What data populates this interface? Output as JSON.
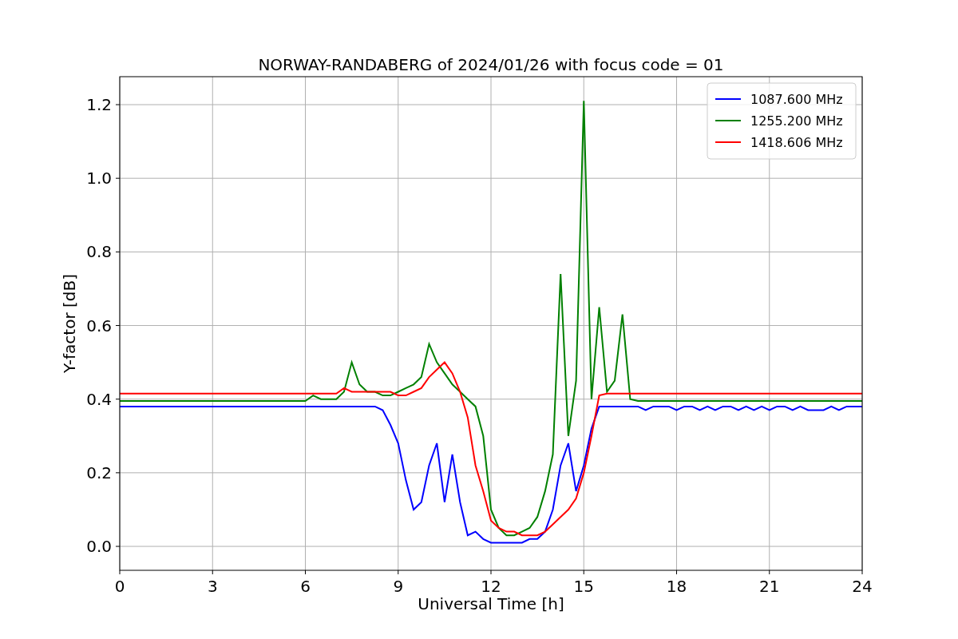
{
  "figure": {
    "chart_data": {
      "type": "line",
      "title": "NORWAY-RANDABERG of 2024/01/26 with focus code = 01",
      "xlabel": "Universal Time [h]",
      "ylabel": "Y-factor [dB]",
      "x": [
        0,
        0.25,
        0.5,
        0.75,
        1,
        1.25,
        1.5,
        1.75,
        2,
        2.25,
        2.5,
        2.75,
        3,
        3.25,
        3.5,
        3.75,
        4,
        4.25,
        4.5,
        4.75,
        5,
        5.25,
        5.5,
        5.75,
        6,
        6.25,
        6.5,
        6.75,
        7,
        7.25,
        7.5,
        7.75,
        8,
        8.25,
        8.5,
        8.75,
        9,
        9.25,
        9.5,
        9.75,
        10,
        10.25,
        10.5,
        10.75,
        11,
        11.25,
        11.5,
        11.75,
        12,
        12.25,
        12.5,
        12.75,
        13,
        13.25,
        13.5,
        13.75,
        14,
        14.25,
        14.5,
        14.75,
        15,
        15.25,
        15.5,
        15.75,
        16,
        16.25,
        16.5,
        16.75,
        17,
        17.25,
        17.5,
        17.75,
        18,
        18.25,
        18.5,
        18.75,
        19,
        19.25,
        19.5,
        19.75,
        20,
        20.25,
        20.5,
        20.75,
        21,
        21.25,
        21.5,
        21.75,
        22,
        22.25,
        22.5,
        22.75,
        23,
        23.25,
        23.5,
        23.75,
        24
      ],
      "series": [
        {
          "name": "1087.600 MHz",
          "color": "#0000ff",
          "values": [
            0.38,
            0.38,
            0.38,
            0.38,
            0.38,
            0.38,
            0.38,
            0.38,
            0.38,
            0.38,
            0.38,
            0.38,
            0.38,
            0.38,
            0.38,
            0.38,
            0.38,
            0.38,
            0.38,
            0.38,
            0.38,
            0.38,
            0.38,
            0.38,
            0.38,
            0.38,
            0.38,
            0.38,
            0.38,
            0.38,
            0.38,
            0.38,
            0.38,
            0.38,
            0.37,
            0.33,
            0.28,
            0.18,
            0.1,
            0.12,
            0.22,
            0.28,
            0.12,
            0.25,
            0.12,
            0.03,
            0.04,
            0.02,
            0.01,
            0.01,
            0.01,
            0.01,
            0.01,
            0.02,
            0.02,
            0.04,
            0.1,
            0.22,
            0.28,
            0.15,
            0.22,
            0.32,
            0.38,
            0.38,
            0.38,
            0.38,
            0.38,
            0.38,
            0.37,
            0.38,
            0.38,
            0.38,
            0.37,
            0.38,
            0.38,
            0.37,
            0.38,
            0.37,
            0.38,
            0.38,
            0.37,
            0.38,
            0.37,
            0.38,
            0.37,
            0.38,
            0.38,
            0.37,
            0.38,
            0.37,
            0.37,
            0.37,
            0.38,
            0.37,
            0.38,
            0.38,
            0.38
          ]
        },
        {
          "name": "1255.200 MHz",
          "color": "#008000",
          "values": [
            0.395,
            0.395,
            0.395,
            0.395,
            0.395,
            0.395,
            0.395,
            0.395,
            0.395,
            0.395,
            0.395,
            0.395,
            0.395,
            0.395,
            0.395,
            0.395,
            0.395,
            0.395,
            0.395,
            0.395,
            0.395,
            0.395,
            0.395,
            0.395,
            0.395,
            0.41,
            0.4,
            0.4,
            0.4,
            0.42,
            0.5,
            0.44,
            0.42,
            0.42,
            0.41,
            0.41,
            0.42,
            0.43,
            0.44,
            0.46,
            0.55,
            0.5,
            0.47,
            0.44,
            0.42,
            0.4,
            0.38,
            0.3,
            0.1,
            0.05,
            0.03,
            0.03,
            0.04,
            0.05,
            0.08,
            0.15,
            0.25,
            0.74,
            0.3,
            0.45,
            1.21,
            0.4,
            0.65,
            0.42,
            0.45,
            0.63,
            0.4,
            0.395,
            0.395,
            0.395,
            0.395,
            0.395,
            0.395,
            0.395,
            0.395,
            0.395,
            0.395,
            0.395,
            0.395,
            0.395,
            0.395,
            0.395,
            0.395,
            0.395,
            0.395,
            0.395,
            0.395,
            0.395,
            0.395,
            0.395,
            0.395,
            0.395,
            0.395,
            0.395,
            0.395,
            0.395,
            0.395
          ]
        },
        {
          "name": "1418.606 MHz",
          "color": "#ff0000",
          "values": [
            0.415,
            0.415,
            0.415,
            0.415,
            0.415,
            0.415,
            0.415,
            0.415,
            0.415,
            0.415,
            0.415,
            0.415,
            0.415,
            0.415,
            0.415,
            0.415,
            0.415,
            0.415,
            0.415,
            0.415,
            0.415,
            0.415,
            0.415,
            0.415,
            0.415,
            0.415,
            0.415,
            0.415,
            0.415,
            0.43,
            0.42,
            0.42,
            0.42,
            0.42,
            0.42,
            0.42,
            0.41,
            0.41,
            0.42,
            0.43,
            0.46,
            0.48,
            0.5,
            0.47,
            0.42,
            0.35,
            0.22,
            0.15,
            0.07,
            0.05,
            0.04,
            0.04,
            0.03,
            0.03,
            0.03,
            0.04,
            0.06,
            0.08,
            0.1,
            0.13,
            0.2,
            0.3,
            0.41,
            0.415,
            0.415,
            0.415,
            0.415,
            0.415,
            0.415,
            0.415,
            0.415,
            0.415,
            0.415,
            0.415,
            0.415,
            0.415,
            0.415,
            0.415,
            0.415,
            0.415,
            0.415,
            0.415,
            0.415,
            0.415,
            0.415,
            0.415,
            0.415,
            0.415,
            0.415,
            0.415,
            0.415,
            0.415,
            0.415,
            0.415,
            0.415,
            0.415,
            0.415
          ]
        }
      ],
      "xlim": [
        0,
        24
      ],
      "ylim": [
        -0.065,
        1.276
      ],
      "xticks": [
        0,
        3,
        6,
        9,
        12,
        15,
        18,
        21,
        24
      ],
      "yticks": [
        {
          "value": 0,
          "label": "0.0"
        },
        {
          "value": 0.2,
          "label": "0.2"
        },
        {
          "value": 0.4,
          "label": "0.4"
        },
        {
          "value": 0.6,
          "label": "0.6"
        },
        {
          "value": 0.8,
          "label": "0.8"
        },
        {
          "value": 1.0,
          "label": "1.0"
        },
        {
          "value": 1.2,
          "label": "1.2"
        }
      ],
      "grid": true,
      "legend": true
    }
  }
}
